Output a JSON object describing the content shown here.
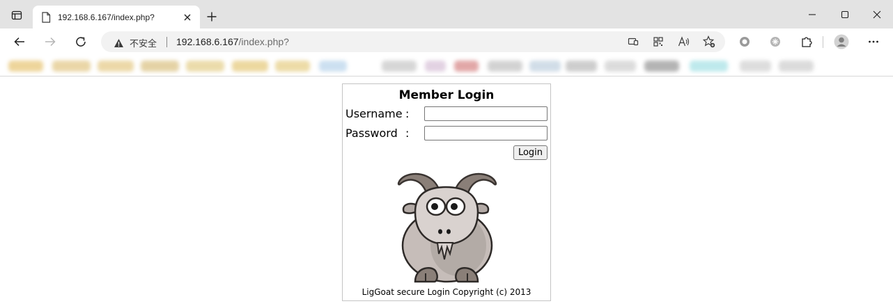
{
  "browser": {
    "tab": {
      "title": "192.168.6.167/index.php?"
    },
    "address": {
      "security_label": "不安全",
      "url_host": "192.168.6.167",
      "url_path": "/index.php?"
    }
  },
  "page": {
    "title": "Member Login",
    "username_label": "Username",
    "password_label": "Password",
    "colon": ":",
    "username_value": "",
    "password_value": "",
    "login_button": "Login",
    "copyright": "LigGoat secure Login Copyright (c) 2013"
  },
  "icons": {
    "tab_actions": "tab-actions-icon",
    "page": "page-icon",
    "close": "close-icon",
    "new_tab": "plus-icon",
    "minimize": "minimize-icon",
    "maximize": "maximize-icon",
    "window_close": "close-icon",
    "back": "back-arrow-icon",
    "forward": "forward-arrow-icon",
    "refresh": "refresh-icon",
    "warning": "warning-icon",
    "more": "more-icon"
  },
  "colors": {
    "tabbar_bg": "#e3e3e3",
    "address_bg": "#f2f2f2",
    "goat_body": "#c6bdb9",
    "goat_horn": "#8a7f78"
  }
}
